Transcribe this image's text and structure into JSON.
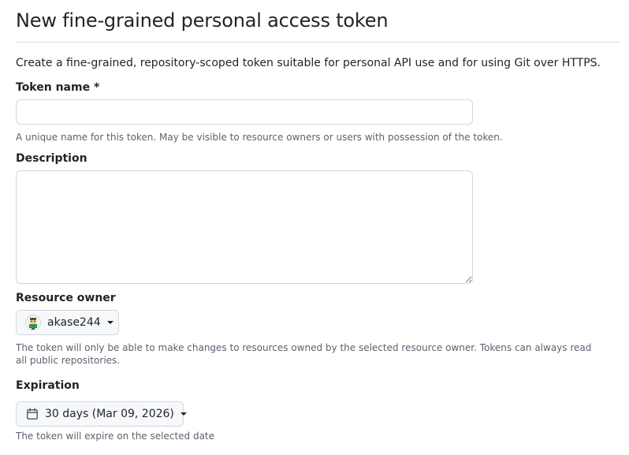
{
  "page": {
    "title": "New fine-grained personal access token",
    "intro": "Create a fine-grained, repository-scoped token suitable for personal API use and for using Git over HTTPS."
  },
  "token_name": {
    "label": "Token name *",
    "value": "",
    "placeholder": "",
    "hint": "A unique name for this token. May be visible to resource owners or users with possession of the token."
  },
  "description": {
    "label": "Description",
    "value": ""
  },
  "resource_owner": {
    "label": "Resource owner",
    "selected": "akase244",
    "avatar_icon": "user-avatar",
    "hint": "The token will only be able to make changes to resources owned by the selected resource owner. Tokens can always read all public repositories."
  },
  "expiration": {
    "label": "Expiration",
    "selected": "30 days (Mar 09, 2026)",
    "icon": "calendar-icon",
    "hint": "The token will expire on the selected date"
  },
  "colors": {
    "text": "#1f2328",
    "muted": "#59636e",
    "border": "#d1d9e0",
    "button_bg": "#f6f8fa"
  }
}
